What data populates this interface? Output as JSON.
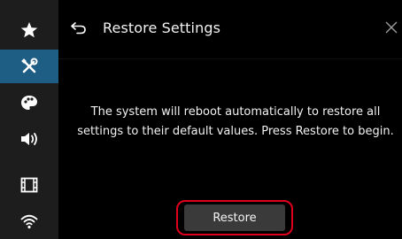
{
  "sidebar": {
    "items": [
      {
        "icon": "star-icon",
        "active": false
      },
      {
        "icon": "tools-icon",
        "active": true
      },
      {
        "icon": "palette-icon",
        "active": false
      },
      {
        "icon": "speaker-icon",
        "active": false
      },
      {
        "icon": "film-icon",
        "active": false
      },
      {
        "icon": "wifi-icon",
        "active": false
      }
    ],
    "active_color": "#1e5d84",
    "background": "#1d1d1d"
  },
  "header": {
    "title": "Restore Settings",
    "back_icon": "back-arrow-icon",
    "close_icon": "close-icon"
  },
  "dialog": {
    "message": "The system will reboot automatically to restore all settings to their default values. Press Restore to begin.",
    "restore_label": "Restore",
    "highlight_color": "#e0001b"
  }
}
